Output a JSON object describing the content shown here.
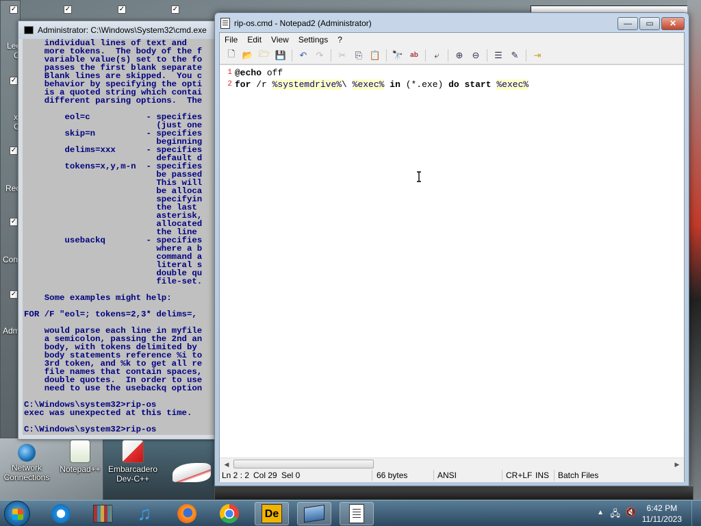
{
  "desktop": {
    "icons": [
      {
        "label": "Network\nConnections",
        "name": "network-connections"
      },
      {
        "label": "Notepad++",
        "name": "notepad-plus-plus"
      },
      {
        "label": "Embarcadero\nDev-C++",
        "name": "embarcadero-devcpp"
      }
    ],
    "edge_labels": [
      "Lee",
      "C",
      "x",
      "C",
      "Rec",
      "Con",
      "Adm"
    ]
  },
  "cmd_window": {
    "title": "Administrator: C:\\Windows\\System32\\cmd.exe",
    "lines": [
      "    individual lines of text and",
      "    more tokens.  The body of the f",
      "    variable value(s) set to the fo",
      "    passes the first blank separate",
      "    Blank lines are skipped.  You c",
      "    behavior by specifying the opti",
      "    is a quoted string which contai",
      "    different parsing options.  The",
      "",
      "        eol=c           - specifies",
      "                          (just one",
      "        skip=n          - specifies",
      "                          beginning",
      "        delims=xxx      - specifies",
      "                          default d",
      "        tokens=x,y,m-n  - specifies",
      "                          be passed",
      "                          This will",
      "                          be alloca",
      "                          specifyin",
      "                          the last",
      "                          asterisk,",
      "                          allocated",
      "                          the line",
      "        usebackq        - specifies",
      "                          where a b",
      "                          command a",
      "                          literal s",
      "                          double qu",
      "                          file-set.",
      "",
      "    Some examples might help:",
      "",
      "FOR /F \"eol=; tokens=2,3* delims=,",
      "",
      "    would parse each line in myfile",
      "    a semicolon, passing the 2nd an",
      "    body, with tokens delimited by",
      "    body statements reference %i to",
      "    3rd token, and %k to get all re",
      "    file names that contain spaces,",
      "    double quotes.  In order to use",
      "    need to use the usebackq option",
      "",
      "C:\\Windows\\system32>rip-os",
      "exec was unexpected at this time.",
      "",
      "C:\\Windows\\system32>rip-os"
    ]
  },
  "notepad": {
    "title": "rip-os.cmd - Notepad2 (Administrator)",
    "menu": [
      "File",
      "Edit",
      "View",
      "Settings",
      "?"
    ],
    "code_lines": [
      {
        "num": "1",
        "tokens": [
          {
            "t": "@echo",
            "c": "kw"
          },
          {
            "t": " off",
            "c": ""
          }
        ]
      },
      {
        "num": "2",
        "tokens": [
          {
            "t": "for",
            "c": "kw"
          },
          {
            "t": " /r ",
            "c": ""
          },
          {
            "t": "%systemdrive%",
            "c": "var"
          },
          {
            "t": "\\ ",
            "c": ""
          },
          {
            "t": "%exec%",
            "c": "var"
          },
          {
            "t": " ",
            "c": ""
          },
          {
            "t": "in",
            "c": "kw"
          },
          {
            "t": " (*.exe) ",
            "c": ""
          },
          {
            "t": "do",
            "c": "kw"
          },
          {
            "t": " ",
            "c": ""
          },
          {
            "t": "start",
            "c": "kw"
          },
          {
            "t": " ",
            "c": ""
          },
          {
            "t": "%exec%",
            "c": "var"
          }
        ]
      }
    ],
    "status": {
      "position": "Ln 2 : 2",
      "col": "Col 29",
      "sel": "Sel 0",
      "size": "66 bytes",
      "encoding": "ANSI",
      "eol": "CR+LF",
      "mode": "INS",
      "lexer": "Batch Files"
    }
  },
  "taskbar": {
    "apps": [
      "internet-explorer",
      "winrar",
      "itunes",
      "firefox",
      "chrome",
      "embarcadero-devcpp",
      "remote-desktop",
      "notepad2"
    ],
    "clock_time": "6:42 PM",
    "clock_date": "11/11/2023"
  },
  "colors": {
    "cmd_text": "#000080",
    "cmd_bg": "#c0c0c0",
    "line_number": "#dd2222",
    "close_button": "#c5452d"
  }
}
